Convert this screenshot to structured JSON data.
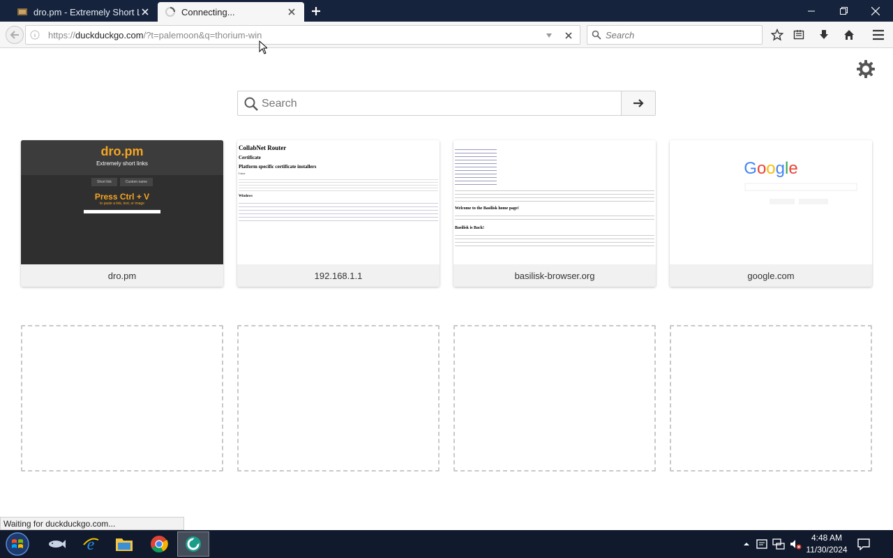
{
  "tabs": [
    {
      "title": "dro.pm - Extremely Short Li",
      "state": "inactive"
    },
    {
      "title": "Connecting...",
      "state": "active-loading"
    }
  ],
  "window_controls": [
    "minimize-icon",
    "restore-icon",
    "close-icon"
  ],
  "navbar": {
    "url_prefix": "https://",
    "url_domain": "duckduckgo.com",
    "url_path": "/?t=palemoon&q=thorium-win",
    "search_placeholder": "Search"
  },
  "page": {
    "search_placeholder": "Search",
    "tiles": [
      {
        "caption": "dro.pm"
      },
      {
        "caption": "192.168.1.1"
      },
      {
        "caption": "basilisk-browser.org"
      },
      {
        "caption": "google.com"
      }
    ],
    "empty_tiles": 4
  },
  "thumb_dro": {
    "title": "dro.pm",
    "subtitle": "Extremely short links",
    "btn1": "Short link",
    "btn2": "Custom name",
    "press": "Press Ctrl + V",
    "sub": "to paste a link, text, or image"
  },
  "thumb_router": {
    "title": "CollabNet Router",
    "h_cert": "Certificate",
    "h_platform": "Platform specific certificate installers",
    "h_linux": "Linux",
    "h_windows": "Windows"
  },
  "thumb_basilisk": {
    "heading": "Welcome to the Basilisk home page!",
    "heading2": "Basilisk is Back!"
  },
  "thumb_google": {
    "logo": "Google"
  },
  "status_text": "Waiting for duckduckgo.com...",
  "taskbar": {
    "time": "4:48 AM",
    "date": "11/30/2024"
  }
}
